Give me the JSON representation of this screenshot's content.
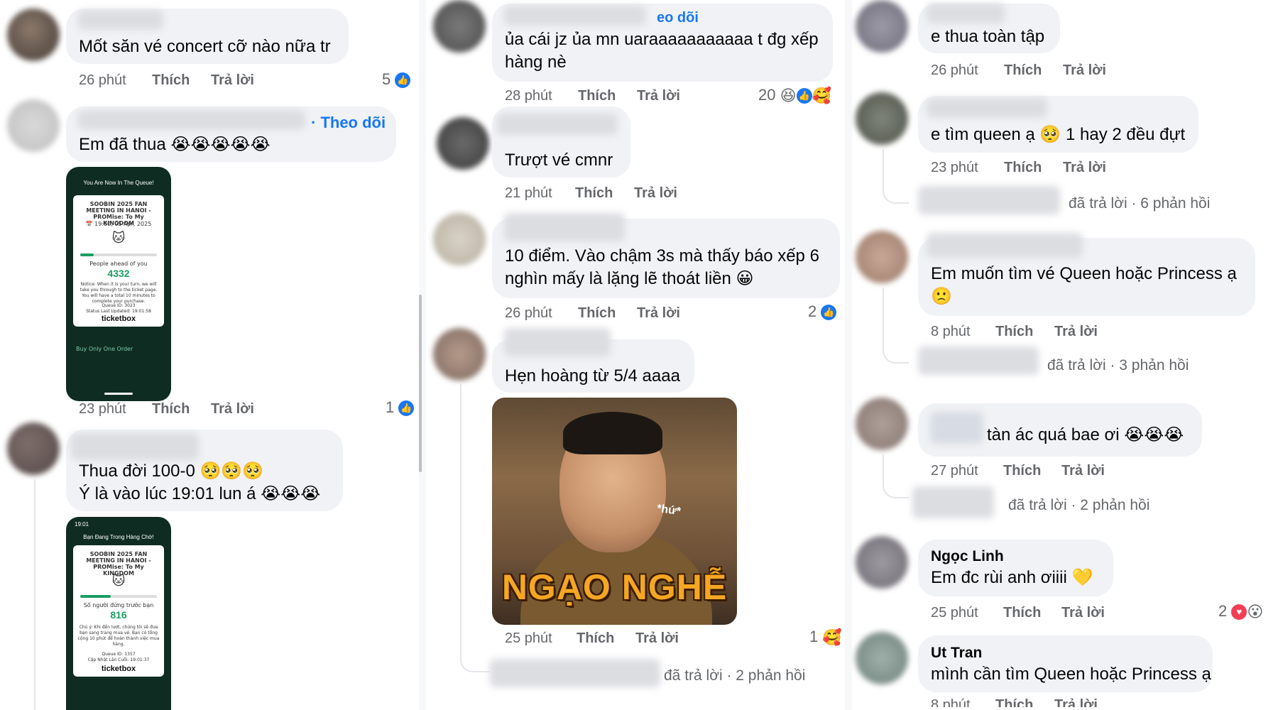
{
  "labels": {
    "like": "Thích",
    "reply": "Trả lời"
  },
  "col1": {
    "c1": {
      "text": "Mốt săn vé concert cỡ nào nữa tr",
      "time": "26 phút",
      "count": "5"
    },
    "c2": {
      "follow": "· Theo dõi",
      "text": "Em đã thua 😭😭😭😭😭",
      "time": "23 phút",
      "count": "1"
    },
    "phone1": {
      "title": "You Are Now In The Queue!",
      "event": "SOOBIN 2025 FAN MEETING IN HANOI - PROMise: To My KINGDOM",
      "date": "📅 19:00, 05 Apr, 2025",
      "ahead_label": "People ahead of you",
      "number": "4332",
      "notice": "Notice: When it is your turn, we will take you through to the ticket page. You will have a total 10 minutes to complete your purchase.",
      "queue_id": "Queue ID: 3023",
      "updated": "Status Last Updated: 19:01:58",
      "brand": "ticketbox",
      "footer": "Buy Only One Order"
    },
    "c3": {
      "line1": "Thua đời 100-0 🥺🥺🥺",
      "line2": "Ý là vào lúc 19:01 lun á 😭😭😭"
    },
    "phone2": {
      "time": "19:01",
      "title": "Bạn Đang Trong Hàng Chờ!",
      "event": "SOOBIN 2025 FAN MEETING IN HANOI - PROMise: To My KINGDOM",
      "ahead_label": "Số người đứng trước bạn",
      "number": "816",
      "notice": "Chú ý: Khi đến lượt, chúng tôi sẽ đưa bạn sang trang mua vé. Bạn có tổng cộng 10 phút để hoàn thành việc mua hàng.",
      "queue_id": "Queue ID: 1357",
      "updated": "Cập Nhật Lần Cuối: 19:01:37",
      "brand": "ticketbox"
    }
  },
  "col2": {
    "c1": {
      "follow": "eo dõi",
      "line1": "ủa cái jz ủa mn uaraaaaaaaaaaa t đg xếp",
      "line2": "hàng nè",
      "time": "28 phút",
      "count": "20"
    },
    "c2": {
      "text": "Trượt vé cmnr",
      "time": "21 phút"
    },
    "c3": {
      "line1": "10 điểm. Vào chậm 3s mà thấy báo xếp 6",
      "line2": "nghìn mấy là lặng lẽ thoát liền 😀",
      "time": "26 phút",
      "count": "2"
    },
    "c4": {
      "text": "Hẹn hoàng từ 5/4 aaaa",
      "time": "25 phút",
      "count": "1"
    },
    "meme": {
      "caption": "NGẠO NGHỄ",
      "tag": "*hứ*"
    },
    "replies": {
      "text": "đã trả lời · 2 phản hồi"
    }
  },
  "col3": {
    "c1": {
      "text": "e thua toàn tập",
      "time": "26 phút"
    },
    "c2": {
      "text": "e tìm queen ạ 🥺 1 hay 2 đều đựt",
      "time": "23 phút",
      "replies": "đã trả lời · 6 phản hồi"
    },
    "c3": {
      "line1": "Em muốn tìm vé Queen hoặc Princess ạ",
      "line2": "🙁",
      "time": "8 phút",
      "replies": "đã trả lời · 3 phản hồi"
    },
    "c4": {
      "text": "tàn ác quá bae ơi 😭😭😭",
      "time": "27 phút",
      "replies": "đã trả lời · 2 phản hồi"
    },
    "c5": {
      "name": "Ngọc Linh",
      "text": "Em đc rùi anh ơiiii 💛",
      "time": "25 phút",
      "count": "2"
    },
    "c6": {
      "name": "Ut Tran",
      "text": "mình cần tìm Queen hoặc Princess ạ",
      "time": "8 phút"
    }
  }
}
